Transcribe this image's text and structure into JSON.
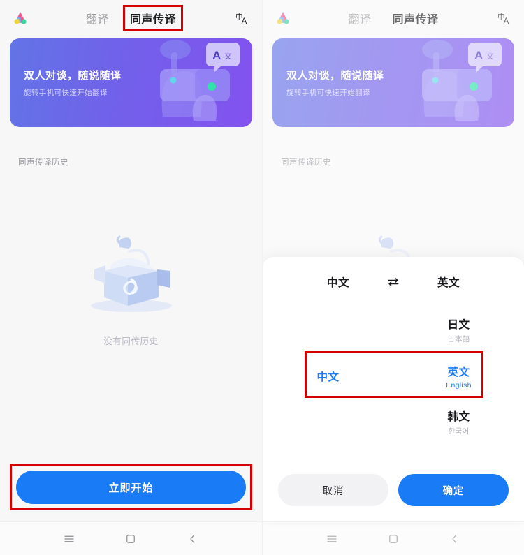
{
  "app": {
    "logo_icon": "colorful-a-logo",
    "translate_icon": "translate-language-icon"
  },
  "header": {
    "tabs": [
      {
        "label": "翻译",
        "active": false
      },
      {
        "label": "同声传译",
        "active": true
      }
    ]
  },
  "banner": {
    "title": "双人对谈，随说随译",
    "subtitle": "旋转手机可快速开始翻译",
    "bubble_text": "A文",
    "gradient_from": "#6274e6",
    "gradient_to": "#8352ef"
  },
  "content": {
    "history_label": "同声传译历史",
    "empty_text": "没有同传历史",
    "empty_icon": "open-box-illustration"
  },
  "actions": {
    "start_label": "立即开始",
    "start_color": "#1a7bf7"
  },
  "navbar": {
    "recents_icon": "menu-icon",
    "home_icon": "square-home-icon",
    "back_icon": "chevron-left-icon"
  },
  "sheet": {
    "source_lang": "中文",
    "swap_icon": "swap-horizontal-icon",
    "target_lang": "英文",
    "source_options": [
      {
        "primary": "中文",
        "secondary": "",
        "selected": true
      }
    ],
    "target_options": [
      {
        "primary": "日文",
        "secondary": "日本語",
        "selected": false
      },
      {
        "primary": "英文",
        "secondary": "English",
        "selected": true
      },
      {
        "primary": "韩文",
        "secondary": "한국어",
        "selected": false
      }
    ],
    "cancel_label": "取消",
    "confirm_label": "确定",
    "selected_color": "#1a7bf7"
  },
  "annotations": {
    "highlight_color": "#d40000",
    "boxes": [
      "同声传译 tab",
      "立即开始 button",
      "中文 ⇌ 英文 row"
    ]
  }
}
